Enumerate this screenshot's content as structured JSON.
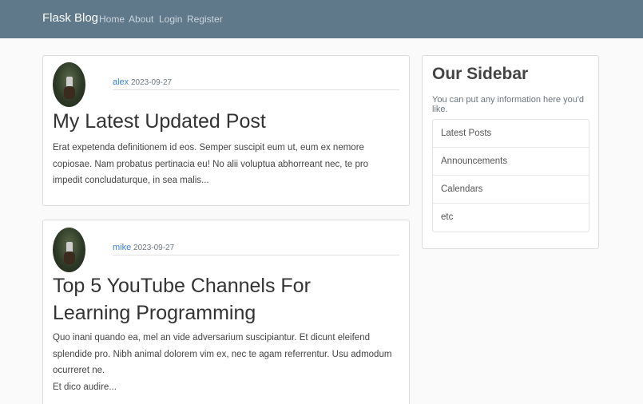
{
  "navbar": {
    "brand": "Flask Blog",
    "links": [
      "Home",
      "About",
      "Login",
      "Register"
    ]
  },
  "posts": [
    {
      "author": "alex",
      "date": "2023-09-27",
      "title": "My Latest Updated Post",
      "excerpt": "Erat expetenda definitionem id eos. Semper suscipit eum ut, eum ex nemore copiosae. Nam probatus pertinacia eu! No alii voluptua abhorreant nec, te pro impedit concludaturque, in sea malis..."
    },
    {
      "author": "mike",
      "date": "2023-09-27",
      "title": "Top 5 YouTube Channels For Learning Programming",
      "excerpt": "Quo inani quando ea, mel an vide adversarium suscipiantur. Et dicunt eleifend splendide pro. Nibh animal dolorem vim ex, nec te agam referrentur. Usu admodum ocurreret ne.",
      "excerpt2": "Et dico audire..."
    }
  ],
  "sidebar": {
    "title": "Our Sidebar",
    "subtitle": "You can put any information here you'd like.",
    "items": [
      "Latest Posts",
      "Announcements",
      "Calendars",
      "etc"
    ]
  }
}
